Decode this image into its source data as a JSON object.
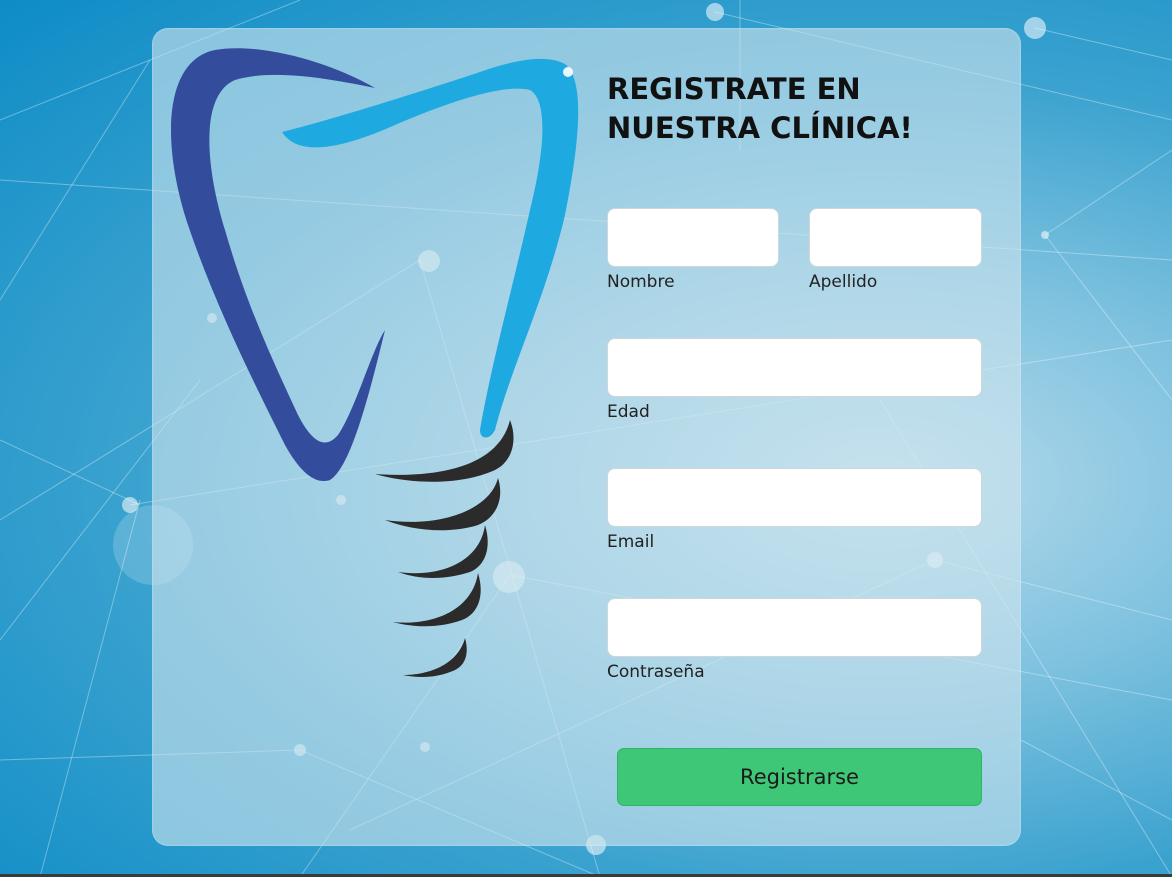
{
  "colors": {
    "background": "#0d8cc6",
    "card": "#cde4ee",
    "tooth_dark": "#334d9c",
    "tooth_light": "#1ea9e1",
    "implant_screw": "#2b2b2b",
    "submit_button": "#3ec777"
  },
  "logo": {
    "icon": "dental-implant-logo"
  },
  "form": {
    "title": "REGISTRATE EN NUESTRA CLÍNICA!",
    "fields": {
      "nombre": {
        "label": "Nombre",
        "value": ""
      },
      "apellido": {
        "label": "Apellido",
        "value": ""
      },
      "edad": {
        "label": "Edad",
        "value": ""
      },
      "email": {
        "label": "Email",
        "value": ""
      },
      "contrasena": {
        "label": "Contraseña",
        "value": ""
      }
    },
    "submit_label": "Registrarse"
  }
}
